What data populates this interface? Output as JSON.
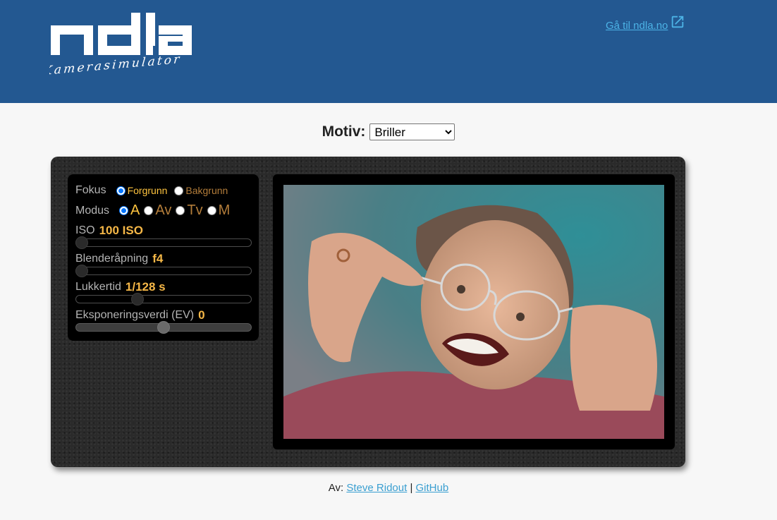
{
  "header": {
    "logo_text": "ndla",
    "logo_subtitle": "Kamerasimulator",
    "ext_link_label": "Gå til ndla.no",
    "ext_link_icon": "external-link-icon",
    "bg_color": "#235891"
  },
  "motiv": {
    "label": "Motiv:",
    "selected": "Briller"
  },
  "controls": {
    "focus_label": "Fokus",
    "focus_options": [
      "Forgrunn",
      "Bakgrunn"
    ],
    "focus_selected": "Forgrunn",
    "mode_label": "Modus",
    "mode_options": [
      "A",
      "Av",
      "Tv",
      "M"
    ],
    "mode_selected": "A",
    "iso": {
      "label": "ISO",
      "value": "100 ISO",
      "slider_fraction": 0.0
    },
    "aperture": {
      "label": "Blenderåpning",
      "value": "f4",
      "slider_fraction": 0.0
    },
    "shutter": {
      "label": "Lukkertid",
      "value": "1/128 s",
      "slider_fraction": 0.34
    },
    "ev": {
      "label": "Eksponeringsverdi (EV)",
      "value": "0",
      "slider_fraction": 0.5
    }
  },
  "colors": {
    "accent": "#f5b747",
    "link": "#4cb3e6",
    "radio_checked": "#0075ff"
  },
  "footer": {
    "prefix": "Av:",
    "author_link": "Steve Ridout",
    "separator": "|",
    "github_link": "GitHub"
  }
}
